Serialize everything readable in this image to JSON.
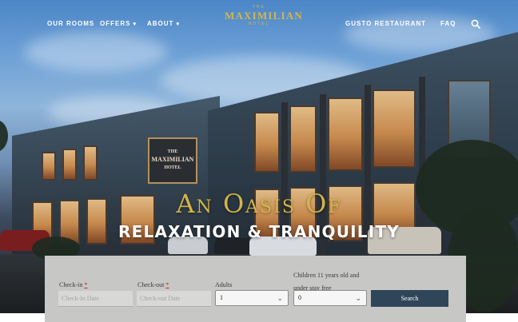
{
  "brand": {
    "logo_top": "THE",
    "logo_main": "MAXIMILIAN",
    "logo_sub": "HOTEL",
    "sign_line1": "THE",
    "sign_line2": "MAXIMILIAN",
    "sign_line3": "HOTEL",
    "gold": "#d3b54a"
  },
  "nav": {
    "left": [
      {
        "label": "OUR ROOMS"
      },
      {
        "label": "OFFERS",
        "caret": "▾"
      },
      {
        "label": "ABOUT",
        "caret": "▾"
      }
    ],
    "right": [
      {
        "label": "GUSTO RESTAURANT"
      },
      {
        "label": "FAQ"
      }
    ],
    "search_icon": "search-icon"
  },
  "hero": {
    "headline_1": "An Oasis Of",
    "headline_2": "RELAXATION & TRANQUILITY"
  },
  "booking": {
    "checkin": {
      "label": "Check-in",
      "required": "*",
      "placeholder": "Check-In Date"
    },
    "checkout": {
      "label": "Check-out",
      "required": "*",
      "placeholder": "Check-out Date"
    },
    "adults": {
      "label": "Adults",
      "value": "1"
    },
    "children": {
      "label_line1": "Children 11 years old and",
      "label_line2": "under stay free",
      "value": "0"
    },
    "submit_label": "Search",
    "button_color": "#2f4659"
  }
}
